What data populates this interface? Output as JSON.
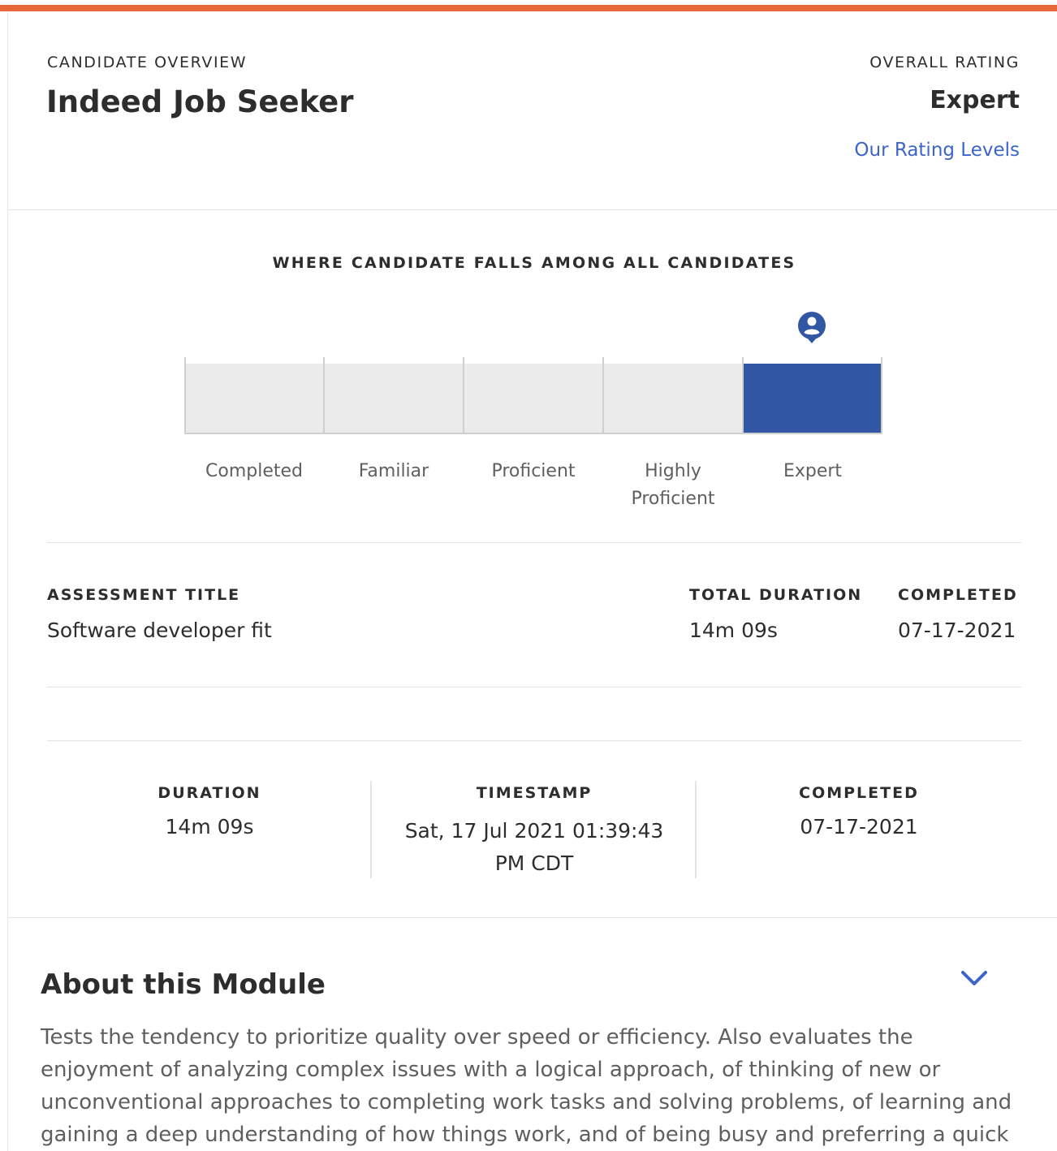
{
  "header": {
    "eyebrow": "CANDIDATE OVERVIEW",
    "candidate_name": "Indeed Job Seeker",
    "rating_eyebrow": "OVERALL RATING",
    "rating_value": "Expert",
    "rating_link": "Our Rating Levels"
  },
  "chart": {
    "title": "WHERE CANDIDATE FALLS AMONG ALL CANDIDATES",
    "levels": [
      {
        "label": "Completed",
        "active": false
      },
      {
        "label": "Familiar",
        "active": false
      },
      {
        "label": "Proficient",
        "active": false
      },
      {
        "label": "Highly Proficient",
        "active": false
      },
      {
        "label": "Expert",
        "active": true
      }
    ],
    "marker_icon": "person-pin-icon",
    "active_color": "#3156a3",
    "inactive_color": "#ebebeb"
  },
  "assessment": {
    "title_label": "ASSESSMENT TITLE",
    "title_value": "Software developer fit",
    "duration_label": "TOTAL DURATION",
    "duration_value": "14m 09s",
    "completed_label": "COMPLETED",
    "completed_value": "07-17-2021"
  },
  "stats": {
    "duration_label": "DURATION",
    "duration_value": "14m 09s",
    "timestamp_label": "TIMESTAMP",
    "timestamp_value": "Sat, 17 Jul 2021 01:39:43 PM CDT",
    "completed_label": "COMPLETED",
    "completed_value": "07-17-2021"
  },
  "about": {
    "title": "About this Module",
    "toggle_icon": "chevron-down-icon",
    "text": "Tests the tendency to prioritize quality over speed or efficiency. Also evaluates the enjoyment of analyzing complex issues with a logical approach, of thinking of new or unconventional approaches to completing work tasks and solving problems, of learning and gaining a deep understanding of how things work, and of being busy and preferring a quick"
  },
  "colors": {
    "accent_bar": "#e8683a",
    "link": "#3b65c9",
    "text_primary": "#2d2d2d",
    "text_secondary": "#5f5f5f"
  }
}
